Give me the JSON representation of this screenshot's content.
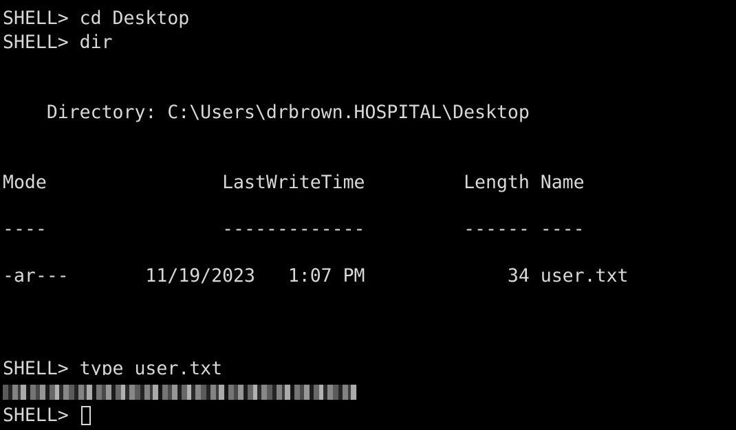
{
  "terminal": {
    "lines": [
      "SHELL> cd Desktop",
      "SHELL> dir",
      "    Directory: C:\\Users\\drbrown.HOSPITAL\\Desktop",
      "Mode                LastWriteTime         Length Name",
      "----                -------------         ------ ----",
      "-ar---       11/19/2023   1:07 PM             34 user.txt",
      "SHELL> type user.txt"
    ],
    "redacted_output": "[redacted flag value]",
    "prompt": "SHELL> "
  },
  "colors": {
    "background": "#000000",
    "foreground": "#d8d8d8"
  }
}
